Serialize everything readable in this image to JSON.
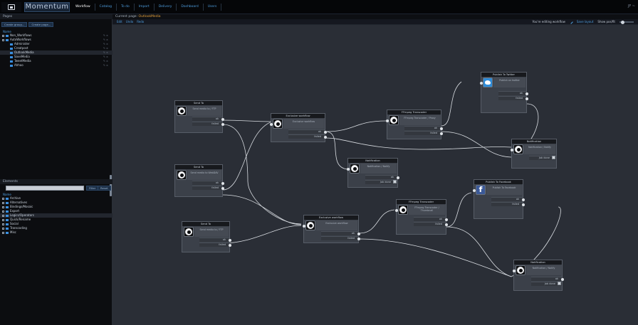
{
  "topbar": {
    "brand": "Momentum",
    "menu": [
      "Workflow",
      "Catalog",
      "To do",
      "Import",
      "Delivery",
      "Dashboard",
      "Users"
    ],
    "active_menu": "Workflow",
    "right_text": "JF ~"
  },
  "pages_panel": {
    "title": "Pages",
    "buttons": [
      "Create group...",
      "Create page..."
    ],
    "tree_header": "Name",
    "items": [
      {
        "label": "Non_Workflows",
        "level": 0,
        "expanded": false,
        "selected": false
      },
      {
        "label": "AutoWorkflows",
        "level": 0,
        "expanded": true,
        "selected": false
      },
      {
        "label": "Administer",
        "level": 1,
        "selected": false
      },
      {
        "label": "Creatpost",
        "level": 1,
        "selected": false
      },
      {
        "label": "OutlookMedia",
        "level": 1,
        "selected": true
      },
      {
        "label": "SaveMedia",
        "level": 1,
        "selected": false
      },
      {
        "label": "TweetMedia",
        "level": 1,
        "selected": false
      },
      {
        "label": "Ahhoo",
        "level": 1,
        "selected": false
      }
    ]
  },
  "elements_panel": {
    "title": "Elements",
    "search_value": "",
    "buttons": [
      "Filter",
      "Reset"
    ],
    "list_header": "Name",
    "items": [
      "Archive",
      "Alternatives",
      "Bindings/Mosaic",
      "Export",
      "Logics/Operators",
      "Quick/Rename",
      "Social",
      "Transcoding",
      "Misc"
    ]
  },
  "editor": {
    "page_label": "Current page:",
    "page_name": "OutlookMedia",
    "toolbar_left": [
      "Edit",
      "Undo",
      "Redo"
    ],
    "editing_text": "You're editing workflow",
    "save_label": "Save layout",
    "zoom_label": "Show pos/fit"
  },
  "nodes": [
    {
      "title": "Send To",
      "desc": "Send media to / FTP",
      "ports": [
        "ok",
        "failed"
      ]
    },
    {
      "title": "Send To",
      "desc": "Send media to WebDAV",
      "ports": [
        "ok",
        "failed"
      ]
    },
    {
      "title": "Send To",
      "desc": "Send media to / FTP",
      "ports": [
        "ok",
        "failed"
      ]
    },
    {
      "title": "Exclusive workflow",
      "desc": "Exclusive workflow",
      "ports": [
        "ok",
        "failed"
      ]
    },
    {
      "title": "Exclusive workflow",
      "desc": "Exclusive workflow",
      "ports": [
        "ok",
        "failed"
      ]
    },
    {
      "title": "FFmpeg Transcoder",
      "desc": "FFmpeg Transcoder / Proxy",
      "ports": [
        "ok",
        "failed"
      ]
    },
    {
      "title": "Publish To Twitter",
      "desc": "Publish on twitter",
      "ports": [
        "ok",
        "failed"
      ]
    },
    {
      "title": "Publish To Facebook",
      "desc": "Publish To Facebook",
      "ports": [
        "ok",
        "failed"
      ]
    },
    {
      "title": "FFmpeg Transcoder",
      "desc": "FFmpeg Transcoder / Thumbnail",
      "ports": [
        "ok",
        "failed"
      ]
    },
    {
      "title": "Notification",
      "desc": "Notification / Notify",
      "ports": [
        "Job done"
      ]
    },
    {
      "title": "Notification",
      "desc": "Notification / Notify",
      "ports": [
        "Job done"
      ]
    },
    {
      "title": "Notification",
      "desc": "Notification / Notify",
      "ports": [
        "Job done"
      ]
    }
  ],
  "colors": {
    "accent": "#4f9fe0",
    "highlight": "#e8a23c",
    "canvas": "#2a2e36",
    "node_body": "#3b4049",
    "node_title": "#17191d",
    "connection": "#d9dde2"
  }
}
